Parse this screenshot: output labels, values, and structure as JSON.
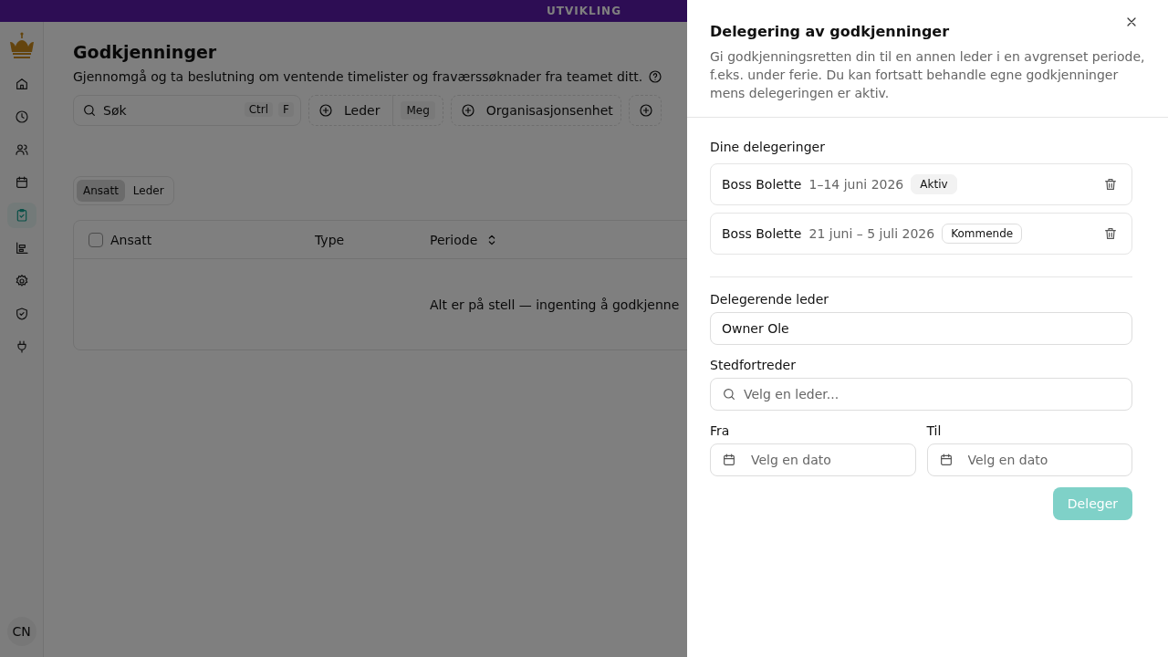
{
  "env_banner": "UTVIKLING",
  "sidebar": {
    "items": [
      {
        "kind": "home",
        "selected": false
      },
      {
        "kind": "clock",
        "selected": false
      },
      {
        "kind": "users",
        "selected": false
      },
      {
        "kind": "calendar",
        "selected": false
      },
      {
        "kind": "clipboard",
        "selected": true
      },
      {
        "kind": "chart",
        "selected": false
      },
      {
        "kind": "gear",
        "selected": false
      },
      {
        "kind": "shield",
        "selected": false
      },
      {
        "kind": "plug",
        "selected": false
      }
    ],
    "avatar": "CN"
  },
  "page": {
    "title": "Godkjenninger",
    "subtitle": "Gjennomgå og ta beslutning om ventende timelister og fraværssøknader fra teamet ditt.",
    "search": {
      "placeholder": "Søk",
      "shortcut": [
        "Ctrl",
        "F"
      ]
    },
    "filters": [
      {
        "kind": "chip",
        "label": "Leder",
        "value": "Meg"
      },
      {
        "kind": "chip",
        "label": "Organisasjonsenhet"
      },
      {
        "kind": "chip"
      }
    ],
    "segments": [
      {
        "label": "Ansatt",
        "selected": true
      },
      {
        "label": "Leder",
        "selected": false
      }
    ],
    "table": {
      "select_all": {
        "checked": false
      },
      "columns": [
        {
          "label": "Ansatt",
          "kind": "check"
        },
        {
          "label": "Type",
          "kind": "plain"
        },
        {
          "label": "Periode",
          "kind": "sort"
        }
      ],
      "empty": "Alt er på stell — ingenting å godkjenne"
    }
  },
  "dialog": {
    "title": "Delegering av godkjenninger",
    "description": "Gi godkjenningsretten din til en annen leder i en avgrenset periode, f.eks. under ferie. Du kan fortsatt behandle egne godkjenninger mens delegeringen er aktiv.",
    "list_label": "Dine delegeringer",
    "delegations": [
      {
        "name": "Boss Bolette",
        "period": "1–14 juni 2026",
        "status": "Aktiv",
        "kind": "active"
      },
      {
        "name": "Boss Bolette",
        "period": "21 juni – 5 juli 2026",
        "status": "Kommende",
        "kind": "upcoming"
      }
    ],
    "fields": {
      "manager": {
        "label": "Delegerende leder",
        "value": "Owner Ole"
      },
      "deputy": {
        "label": "Stedfortreder",
        "placeholder": "Velg en leder..."
      },
      "from": {
        "label": "Fra",
        "placeholder": "Velg en dato"
      },
      "to": {
        "label": "Til",
        "placeholder": "Velg en dato"
      }
    },
    "submit": {
      "label": "Deleger",
      "disabled": true
    }
  }
}
